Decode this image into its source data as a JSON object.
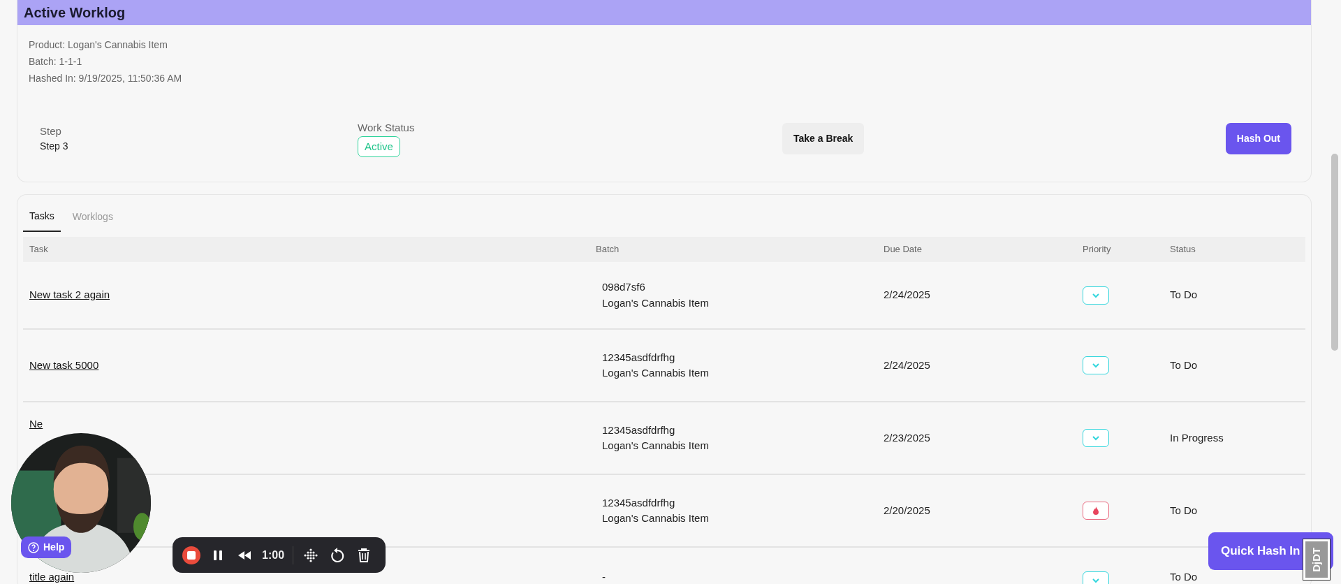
{
  "header": {
    "title": "Active Worklog"
  },
  "details": [
    "Product: Logan's Cannabis Item",
    "Batch: 1-1-1",
    "Hashed In: 9/19/2025, 11:50:36 AM"
  ],
  "step": {
    "label": "Step",
    "value": "Step 3"
  },
  "work_status": {
    "label": "Work Status",
    "value": "Active"
  },
  "actions": [
    {
      "label": "Take a Break",
      "kind": "secondary"
    },
    {
      "label": "Hash Out",
      "kind": "primary"
    }
  ],
  "tabs": [
    {
      "label": "Tasks",
      "selected": true
    },
    {
      "label": "Worklogs",
      "selected": false
    }
  ],
  "table": {
    "columns": [
      "Task",
      "Batch",
      "Due Date",
      "Priority",
      "Status"
    ],
    "rows": [
      {
        "task": "New task 2 again",
        "batch_code": "098d7sf6",
        "product": "Logan's Cannabis Item",
        "due_date": "2/24/2025",
        "high_priority": false,
        "status": "To Do"
      },
      {
        "task": "New task 5000",
        "batch_code": "12345asdfdrfhg",
        "product": "Logan's Cannabis Item",
        "due_date": "2/24/2025",
        "high_priority": false,
        "status": "To Do"
      },
      {
        "task": "Ne",
        "batch_code": "12345asdfdrfhg",
        "product": "Logan's Cannabis Item",
        "due_date": "2/23/2025",
        "high_priority": false,
        "status": "In Progress"
      },
      {
        "batch_code": "12345asdfdrfhg",
        "product": "Logan's Cannabis Item",
        "due_date": "2/20/2025",
        "high_priority": true,
        "status": "To Do"
      },
      {
        "task": "title again",
        "batch_code": "-",
        "high_priority": false,
        "status": "To Do"
      }
    ]
  },
  "help_button": {
    "label": "Help"
  },
  "recorder": {
    "time": "1:00"
  },
  "quick_hash_in": {
    "label": "Quick Hash In"
  },
  "debug_toolbar": {
    "label": "DjDT"
  }
}
